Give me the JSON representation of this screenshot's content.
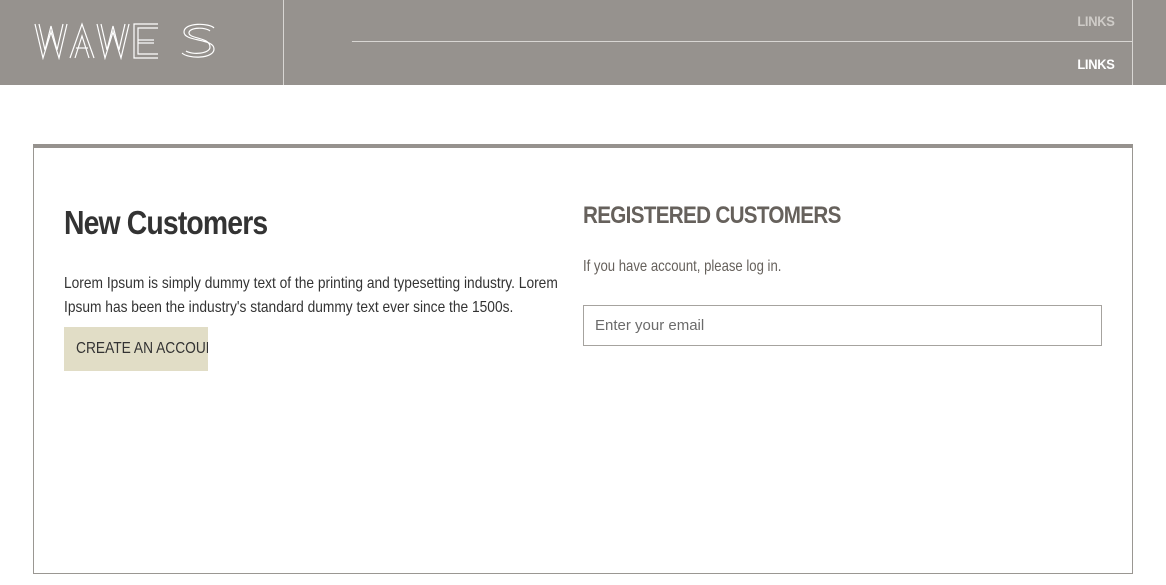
{
  "header": {
    "logo_text": "WAWES",
    "links_top": "LINKS",
    "links_bottom": "LINKS",
    "colors": {
      "bar": "#96928e",
      "divider": "#d8d6d3",
      "link_muted": "#cfccc8",
      "link_active": "#ffffff"
    }
  },
  "new_customers": {
    "title": "New Customers",
    "text": "Lorem Ipsum is simply dummy text of the printing and typesetting industry. Lorem Ipsum has been the industry's standard dummy text ever since the 1500s.",
    "button_label": "CREATE AN ACCOUNT",
    "button_color": "#e1ddc6"
  },
  "registered_customers": {
    "title": "REGISTERED CUSTOMERS",
    "text": "If you have account, please log in.",
    "email_placeholder": "Enter your email",
    "email_value": ""
  }
}
